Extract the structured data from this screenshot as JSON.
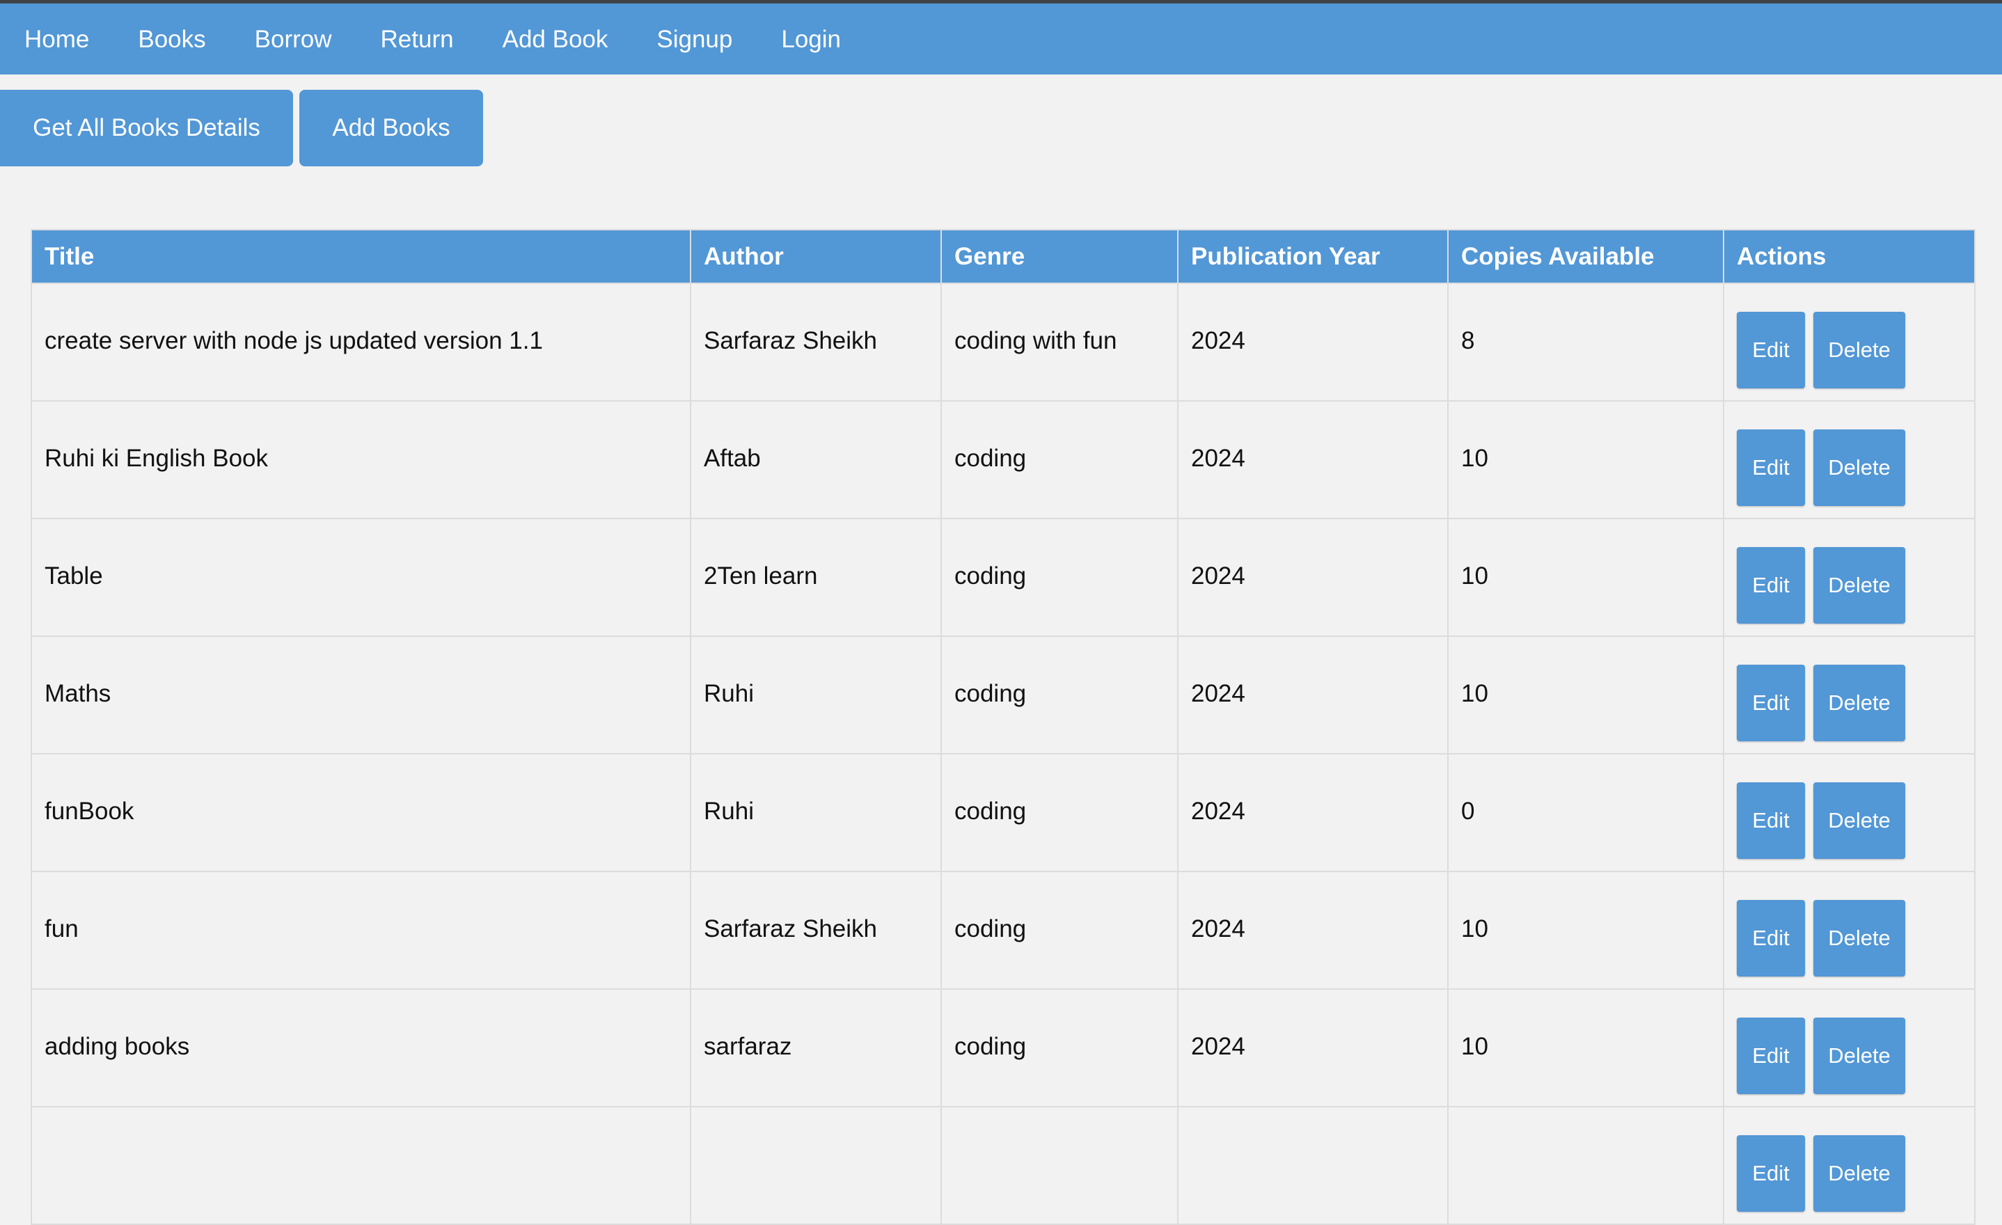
{
  "nav": {
    "items": [
      {
        "label": "Home"
      },
      {
        "label": "Books"
      },
      {
        "label": "Borrow"
      },
      {
        "label": "Return"
      },
      {
        "label": "Add Book"
      },
      {
        "label": "Signup"
      },
      {
        "label": "Login"
      }
    ]
  },
  "actions": {
    "get_all_label": "Get All Books Details",
    "add_books_label": "Add Books"
  },
  "table": {
    "headers": [
      "Title",
      "Author",
      "Genre",
      "Publication Year",
      "Copies Available",
      "Actions"
    ],
    "rows": [
      {
        "title": "create server with node js updated version 1.1",
        "author": "Sarfaraz Sheikh",
        "genre": "coding with fun",
        "year": "2024",
        "copies": "8"
      },
      {
        "title": "Ruhi ki English Book",
        "author": "Aftab",
        "genre": "coding",
        "year": "2024",
        "copies": "10"
      },
      {
        "title": "Table",
        "author": "2Ten learn",
        "genre": "coding",
        "year": "2024",
        "copies": "10"
      },
      {
        "title": "Maths",
        "author": "Ruhi",
        "genre": "coding",
        "year": "2024",
        "copies": "10"
      },
      {
        "title": "funBook",
        "author": "Ruhi",
        "genre": "coding",
        "year": "2024",
        "copies": "0"
      },
      {
        "title": "fun",
        "author": "Sarfaraz Sheikh",
        "genre": "coding",
        "year": "2024",
        "copies": "10"
      },
      {
        "title": "adding books",
        "author": "sarfaraz",
        "genre": "coding",
        "year": "2024",
        "copies": "10"
      },
      {
        "title": "",
        "author": "",
        "genre": "",
        "year": "",
        "copies": ""
      }
    ],
    "edit_label": "Edit",
    "delete_label": "Delete"
  },
  "colors": {
    "accent": "#5297d6",
    "background": "#f2f2f2",
    "border": "#dcdcdc"
  }
}
